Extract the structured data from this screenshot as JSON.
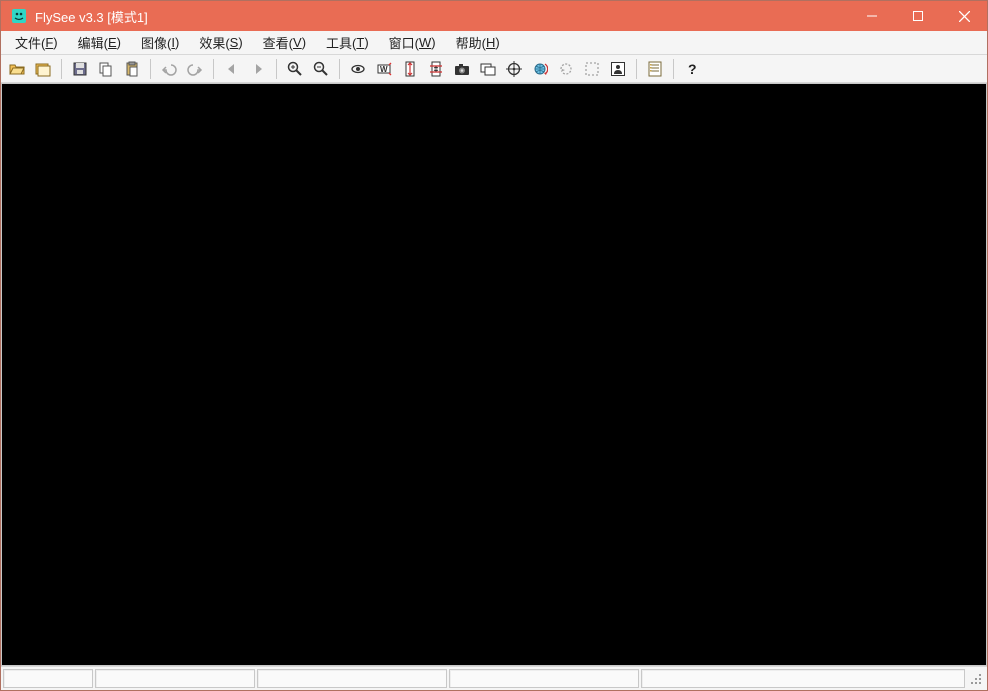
{
  "window": {
    "title": "FlySee v3.3 [模式1]"
  },
  "menu": {
    "items": [
      {
        "label": "文件",
        "hotkey": "F"
      },
      {
        "label": "编辑",
        "hotkey": "E"
      },
      {
        "label": "图像",
        "hotkey": "I"
      },
      {
        "label": "效果",
        "hotkey": "S"
      },
      {
        "label": "查看",
        "hotkey": "V"
      },
      {
        "label": "工具",
        "hotkey": "T"
      },
      {
        "label": "窗口",
        "hotkey": "W"
      },
      {
        "label": "帮助",
        "hotkey": "H"
      }
    ]
  },
  "toolbar": {
    "groups": [
      [
        "open",
        "open-new"
      ],
      [
        "save",
        "copy",
        "paste"
      ],
      [
        "undo",
        "redo"
      ],
      [
        "prev",
        "next"
      ],
      [
        "zoom-in",
        "zoom-out"
      ],
      [
        "view",
        "width-fit",
        "height-stretch",
        "height-crop",
        "camera",
        "copy-screen",
        "target",
        "rotate-globe",
        "rotate-dashed",
        "select-dashed",
        "person-rect"
      ],
      [
        "list-doc"
      ],
      [
        "help"
      ]
    ],
    "disabled": [
      "undo",
      "redo",
      "prev",
      "next",
      "rotate-dashed",
      "select-dashed"
    ]
  },
  "status": {
    "panes": [
      "",
      "",
      "",
      "",
      ""
    ]
  }
}
